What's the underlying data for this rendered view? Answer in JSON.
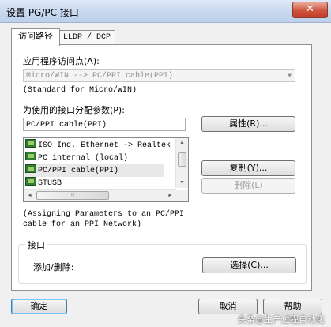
{
  "window": {
    "title": "设置 PG/PC 接口",
    "close_glyph": "✕"
  },
  "tabs": [
    {
      "label": "访问路径",
      "active": true
    },
    {
      "label": "LLDP / DCP",
      "active": false
    }
  ],
  "access_point": {
    "label": "应用程序访问点(A):",
    "value": "Micro/WIN      --> PC/PPI cable(PPI)",
    "description": "(Standard for Micro/WIN)"
  },
  "interface_params": {
    "label": "为使用的接口分配参数(P):",
    "value": "PC/PPI cable(PPI)"
  },
  "interface_list": {
    "items": [
      {
        "label": "ISO Ind. Ethernet -> Realtek",
        "selected": false
      },
      {
        "label": "PC internal (local)",
        "selected": false
      },
      {
        "label": "PC/PPI cable(PPI)",
        "selected": true
      },
      {
        "label": "STUSB",
        "selected": false
      }
    ],
    "hscroll_grip": "⦙⦙⦙"
  },
  "buttons": {
    "properties": "属性(R)...",
    "copy": "复制(Y)...",
    "delete": "删除(L)",
    "select": "选择(C)...",
    "ok": "确定",
    "cancel": "取消",
    "help": "帮助"
  },
  "assign_description": "(Assigning Parameters to an PC/PPI\ncable for an PPI Network)",
  "interface_group": {
    "legend": "接口",
    "add_remove_label": "添加/删除:"
  },
  "watermark": "头条@生产过程自动化"
}
